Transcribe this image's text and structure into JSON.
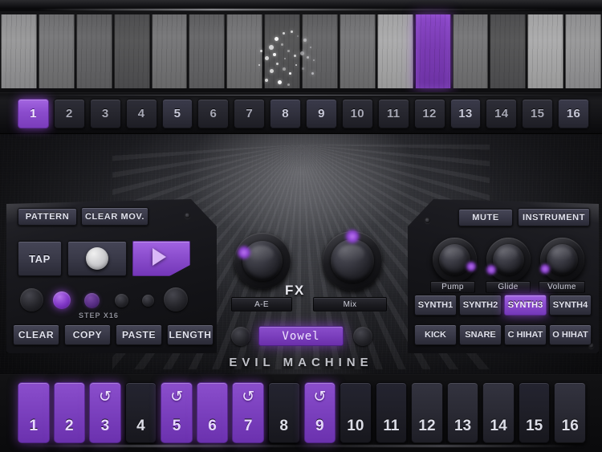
{
  "app": {
    "brand": "EVIL MACHINE",
    "accent_purple": "#8b4ecc",
    "accent_purple_bright": "#a365e0",
    "panel_dark": "#1c1c21",
    "button_face": "#3a3a49",
    "text_light": "#e2e3ee"
  },
  "keyboard": {
    "key_count": 16,
    "active_key_index": 11,
    "particles_label": "particle-burst"
  },
  "pattern_bar": {
    "active_index": 0,
    "buttons": [
      "1",
      "2",
      "3",
      "4",
      "5",
      "6",
      "7",
      "8",
      "9",
      "10",
      "11",
      "12",
      "13",
      "14",
      "15",
      "16"
    ]
  },
  "left_panel": {
    "pattern_label": "PATTERN",
    "clear_mov_label": "CLEAR MOV.",
    "tap_label": "TAP",
    "record_label": "record-button",
    "play_label": "play-button",
    "step_label": "STEP X16",
    "leds": [
      {
        "name": "led-1",
        "state": "off"
      },
      {
        "name": "led-2",
        "state": "on"
      },
      {
        "name": "led-3",
        "state": "on-dim"
      },
      {
        "name": "led-4",
        "state": "off"
      },
      {
        "name": "led-5",
        "state": "off"
      },
      {
        "name": "led-6",
        "state": "off"
      }
    ],
    "bottom_buttons": [
      "CLEAR",
      "COPY",
      "PASTE",
      "LENGTH"
    ]
  },
  "fx_section": {
    "title": "FX",
    "knobs": [
      {
        "name": "fx-knob-a-e",
        "label": "A-E",
        "indicator_angle_deg": 310
      },
      {
        "name": "fx-knob-mix",
        "label": "Mix",
        "indicator_angle_deg": 0
      }
    ],
    "preset_value": "Vowel",
    "prev_button": "fx-prev-button",
    "next_button": "fx-next-button"
  },
  "right_panel": {
    "mute_label": "MUTE",
    "instrument_label": "INSTRUMENT",
    "knobs": [
      {
        "name": "pump-knob",
        "label": "Pump",
        "indicator_angle_deg": 115
      },
      {
        "name": "glide-knob",
        "label": "Glide",
        "indicator_angle_deg": 225
      },
      {
        "name": "volume-knob",
        "label": "Volume",
        "indicator_angle_deg": 225
      }
    ],
    "instrument_rows": [
      [
        {
          "label": "SYNTH1",
          "selected": false
        },
        {
          "label": "SYNTH2",
          "selected": false
        },
        {
          "label": "SYNTH3",
          "selected": true
        },
        {
          "label": "SYNTH4",
          "selected": false
        }
      ],
      [
        {
          "label": "KICK",
          "selected": false
        },
        {
          "label": "SNARE",
          "selected": false
        },
        {
          "label": "C HIHAT",
          "selected": false
        },
        {
          "label": "O HIHAT",
          "selected": false
        }
      ]
    ]
  },
  "sequencer": {
    "loop_icon": "↺",
    "steps": [
      {
        "num": "1",
        "on": true,
        "loop": false
      },
      {
        "num": "2",
        "on": true,
        "loop": false
      },
      {
        "num": "3",
        "on": true,
        "loop": true
      },
      {
        "num": "4",
        "on": false,
        "loop": false
      },
      {
        "num": "5",
        "on": true,
        "loop": true
      },
      {
        "num": "6",
        "on": true,
        "loop": false
      },
      {
        "num": "7",
        "on": true,
        "loop": true
      },
      {
        "num": "8",
        "on": false,
        "loop": false
      },
      {
        "num": "9",
        "on": true,
        "loop": true
      },
      {
        "num": "10",
        "on": false,
        "loop": false
      },
      {
        "num": "11",
        "on": false,
        "loop": false
      },
      {
        "num": "12",
        "on": false,
        "loop": false
      },
      {
        "num": "13",
        "on": false,
        "loop": false
      },
      {
        "num": "14",
        "on": false,
        "loop": false
      },
      {
        "num": "15",
        "on": false,
        "loop": false
      },
      {
        "num": "16",
        "on": false,
        "loop": false
      }
    ]
  }
}
